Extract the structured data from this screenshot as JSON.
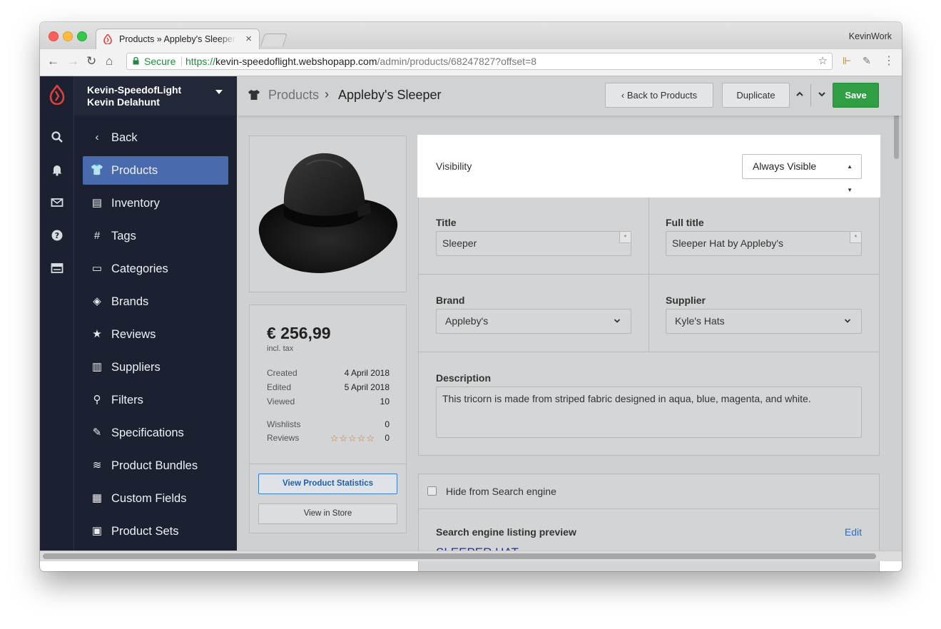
{
  "browser": {
    "tab_title": "Products » Appleby's Sleeper",
    "tab_close": "×",
    "profile": "KevinWork",
    "secure_label": "Secure",
    "url_scheme": "https://",
    "url_host": "kevin-speedoflight.webshopapp.com",
    "url_path": "/admin/products/68247827?offset=8"
  },
  "store": {
    "name": "Kevin-SpeedofLight",
    "user": "Kevin Delahunt"
  },
  "sidebar": {
    "items": [
      {
        "label": "Back",
        "icon": "‹"
      },
      {
        "label": "Products",
        "icon": "👕"
      },
      {
        "label": "Inventory",
        "icon": "▤"
      },
      {
        "label": "Tags",
        "icon": "#"
      },
      {
        "label": "Categories",
        "icon": "▭"
      },
      {
        "label": "Brands",
        "icon": "◈"
      },
      {
        "label": "Reviews",
        "icon": "★"
      },
      {
        "label": "Suppliers",
        "icon": "▥"
      },
      {
        "label": "Filters",
        "icon": "⚲"
      },
      {
        "label": "Specifications",
        "icon": "✎"
      },
      {
        "label": "Product Bundles",
        "icon": "≋"
      },
      {
        "label": "Custom Fields",
        "icon": "▦"
      },
      {
        "label": "Product Sets",
        "icon": "▣"
      }
    ]
  },
  "header": {
    "breadcrumb_parent": "Products",
    "breadcrumb_sep": "›",
    "breadcrumb_current": "Appleby's Sleeper",
    "back_button": "‹  Back to Products",
    "duplicate_button": "Duplicate",
    "save_button": "Save"
  },
  "product_summary": {
    "price": "€ 256,99",
    "price_note": "incl. tax",
    "created_label": "Created",
    "created_value": "4 April 2018",
    "edited_label": "Edited",
    "edited_value": "5 April 2018",
    "viewed_label": "Viewed",
    "viewed_value": "10",
    "wishlists_label": "Wishlists",
    "wishlists_value": "0",
    "reviews_label": "Reviews",
    "reviews_value": "0",
    "stars": "☆☆☆☆☆",
    "view_stats_button": "View Product Statistics",
    "view_store_button": "View in Store"
  },
  "form": {
    "visibility_label": "Visibility",
    "visibility_value": "Always Visible",
    "title_label": "Title",
    "title_value": "Sleeper",
    "full_title_label": "Full title",
    "full_title_value": "Sleeper Hat by Appleby's",
    "required_mark": "*",
    "brand_label": "Brand",
    "brand_value": "Appleby's",
    "supplier_label": "Supplier",
    "supplier_value": "Kyle's Hats",
    "description_label": "Description",
    "description_value": "This tricorn is made from striped fabric designed in aqua, blue, magenta, and white."
  },
  "seo": {
    "hide_label": "Hide from Search engine",
    "preview_title": "Search engine listing preview",
    "edit_link": "Edit",
    "preview_link": "SLEEPER HAT"
  },
  "colors": {
    "sidebar_bg": "#1b2130",
    "active_nav": "#4a6aae",
    "save_green": "#2f9e44",
    "link_blue": "#2f6fc0"
  }
}
